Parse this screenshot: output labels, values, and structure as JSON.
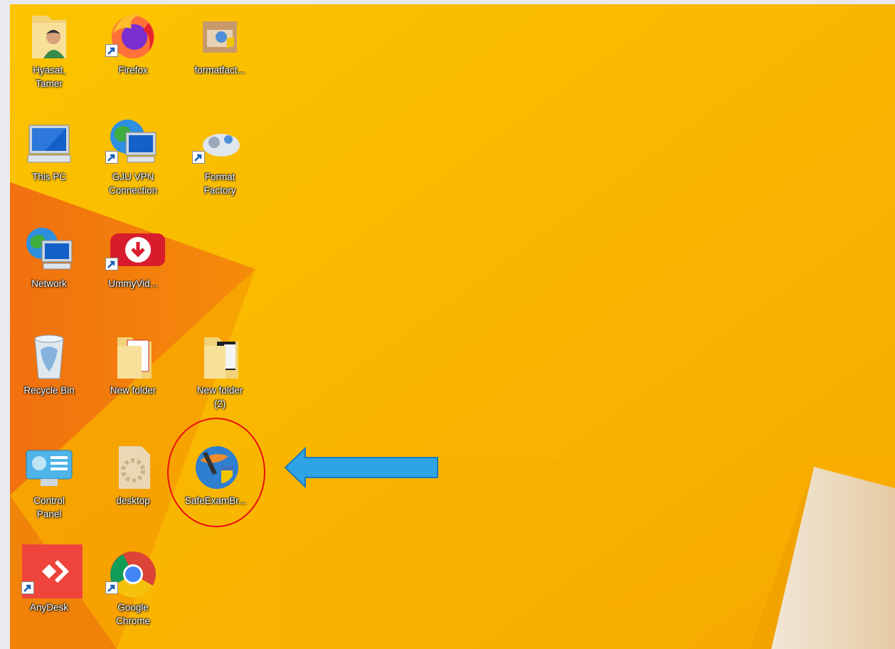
{
  "desktop": {
    "icons": [
      {
        "name": "user-folder",
        "label": "Hyasat,\nTamer",
        "icon": "user-folder-icon",
        "shortcut": false
      },
      {
        "name": "firefox",
        "label": "Firefox",
        "icon": "firefox-icon",
        "shortcut": true
      },
      {
        "name": "formatfactory-installer",
        "label": "formatfact...",
        "icon": "installer-icon",
        "shortcut": false
      },
      {
        "name": "this-pc",
        "label": "This PC",
        "icon": "monitor-icon",
        "shortcut": false
      },
      {
        "name": "gju-vpn",
        "label": "GJU VPN\nConnection",
        "icon": "network-globe-icon",
        "shortcut": true
      },
      {
        "name": "format-factory",
        "label": "Format\nFactory",
        "icon": "format-factory-icon",
        "shortcut": true
      },
      {
        "name": "network",
        "label": "Network",
        "icon": "network-globe-icon",
        "shortcut": false
      },
      {
        "name": "ummyvideo",
        "label": "UmmyVid...",
        "icon": "download-icon",
        "shortcut": true
      },
      {
        "name": "recycle-bin",
        "label": "Recycle Bin",
        "icon": "recycle-bin-icon",
        "shortcut": false
      },
      {
        "name": "new-folder",
        "label": "New folder",
        "icon": "folder-icon",
        "shortcut": false
      },
      {
        "name": "new-folder-2",
        "label": "New folder\n(2)",
        "icon": "folder-icon",
        "shortcut": false
      },
      {
        "name": "control-panel",
        "label": "Control\nPanel",
        "icon": "control-panel-icon",
        "shortcut": false
      },
      {
        "name": "desktop-file",
        "label": "desktop",
        "icon": "settings-file-icon",
        "shortcut": false
      },
      {
        "name": "safe-exam-browser",
        "label": "SafeExamBr...",
        "icon": "safe-exam-browser-icon",
        "shortcut": false
      },
      {
        "name": "anydesk",
        "label": "AnyDesk",
        "icon": "anydesk-icon",
        "shortcut": true
      },
      {
        "name": "google-chrome",
        "label": "Google\nChrome",
        "icon": "chrome-icon",
        "shortcut": true
      }
    ]
  },
  "annotation": {
    "highlight_color": "#e81010",
    "arrow_color": "#2ea3e6",
    "target": "safe-exam-browser"
  },
  "colors": {
    "wallpaper": "#f7b400",
    "wallpaper_dark": "#f07a10"
  }
}
